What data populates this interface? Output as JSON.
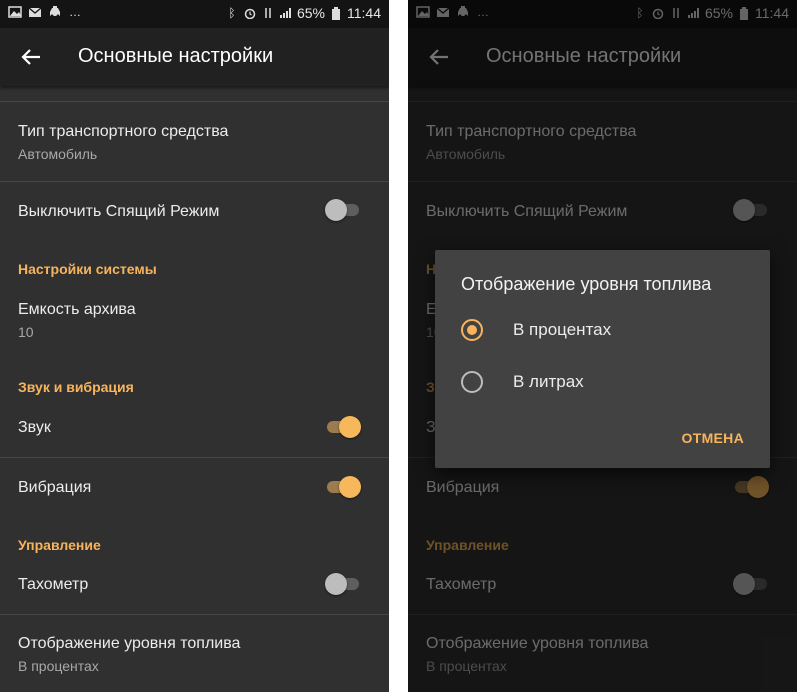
{
  "status_bar": {
    "battery": "65%",
    "time": "11:44"
  },
  "screen": {
    "title": "Основные настройки",
    "items": [
      {
        "title": "Тип транспортного средства",
        "subtitle": "Автомобиль"
      },
      {
        "title": "Выключить Спящий Режим",
        "toggle": false
      },
      {
        "section": "Настройки системы"
      },
      {
        "title": "Емкость архива",
        "subtitle": "10"
      },
      {
        "section": "Звук и вибрация"
      },
      {
        "title": "Звук",
        "toggle": true
      },
      {
        "title": "Вибрация",
        "toggle": true
      },
      {
        "section": "Управление"
      },
      {
        "title": "Тахометр",
        "toggle": false
      },
      {
        "title": "Отображение уровня топлива",
        "subtitle": "В процентах"
      }
    ]
  },
  "dialog": {
    "title": "Отображение уровня топлива",
    "options": [
      {
        "label": "В процентах",
        "selected": true
      },
      {
        "label": "В литрах",
        "selected": false
      }
    ],
    "cancel": "ОТМЕНА"
  },
  "colors": {
    "accent": "#f7b45c",
    "background": "#303030",
    "appbar": "#212121",
    "dialog": "#424242"
  }
}
